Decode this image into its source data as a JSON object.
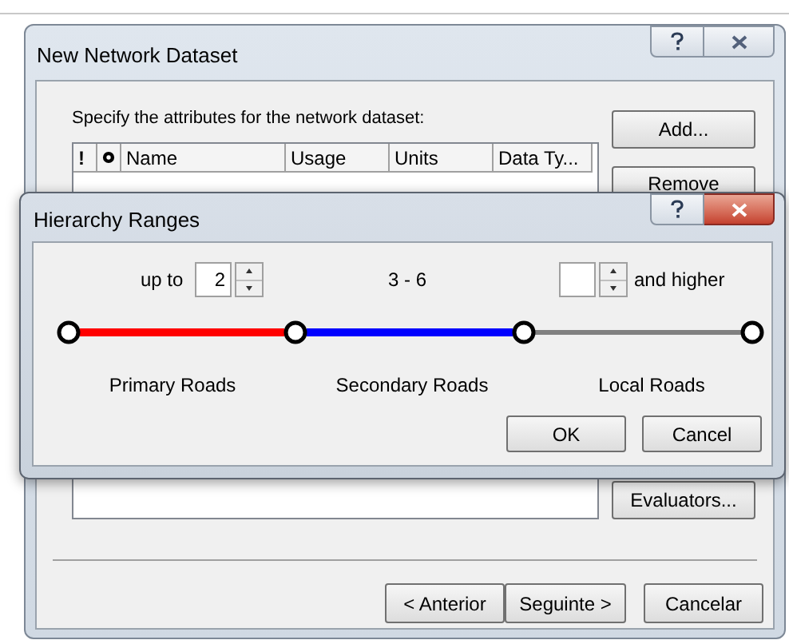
{
  "back_window": {
    "title": "New Network Dataset",
    "prompt": "Specify the attributes for the network dataset:",
    "table": {
      "columns": [
        {
          "kind": "text",
          "label": "!"
        },
        {
          "kind": "icon"
        },
        {
          "kind": "text",
          "label": "Name"
        },
        {
          "kind": "text",
          "label": "Usage"
        },
        {
          "kind": "text",
          "label": "Units"
        },
        {
          "kind": "text",
          "label": "Data Ty..."
        }
      ]
    },
    "side_buttons": [
      "Add...",
      "Remove",
      "Evaluators..."
    ],
    "nav_buttons": [
      "< Anterior",
      "Seguinte >",
      "Cancelar"
    ]
  },
  "front_window": {
    "title": "Hierarchy Ranges",
    "low_label": "up to",
    "low_value": "2",
    "middle_range": "3 - 6",
    "high_label": "and higher",
    "segments": [
      {
        "label": "Primary Roads",
        "color": "#ff0000"
      },
      {
        "label": "Secondary Roads",
        "color": "#0000ff"
      },
      {
        "label": "Local Roads",
        "color": "#808080"
      }
    ],
    "buttons": [
      "OK",
      "Cancel"
    ]
  }
}
